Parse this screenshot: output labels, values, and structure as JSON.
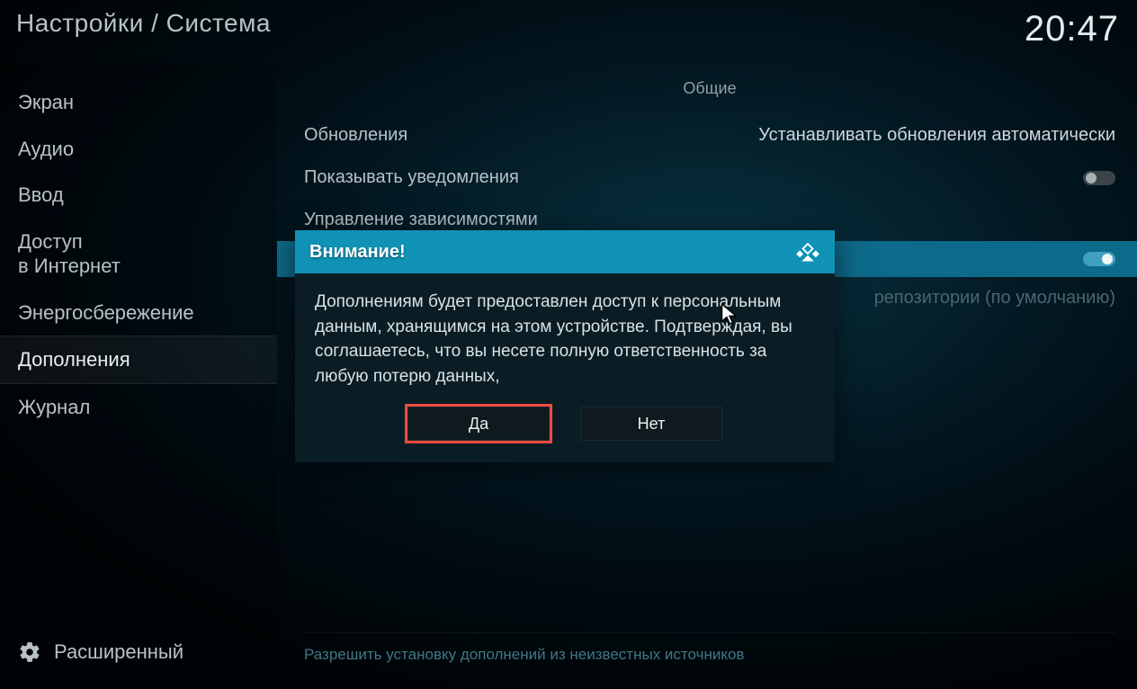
{
  "header": {
    "breadcrumb": "Настройки / Система",
    "clock": "20:47"
  },
  "sidebar": {
    "items": [
      {
        "label": "Экран"
      },
      {
        "label": "Аудио"
      },
      {
        "label": "Ввод"
      },
      {
        "label": "Доступ\nв Интернет"
      },
      {
        "label": "Энергосбережение"
      },
      {
        "label": "Дополнения"
      },
      {
        "label": "Журнал"
      }
    ],
    "level_label": "Расширенный"
  },
  "content": {
    "section_title": "Общие",
    "rows": {
      "updates": {
        "label": "Обновления",
        "value": "Устанавливать обновления автоматически"
      },
      "notifications": {
        "label": "Показывать уведомления"
      },
      "deps": {
        "label": "Управление зависимостями"
      },
      "unknown_highlight_value": "",
      "repos": {
        "value": "репозитории (по умолчанию)"
      }
    },
    "bottom_hint": "Разрешить установку дополнений из неизвестных источников"
  },
  "dialog": {
    "title": "Внимание!",
    "body": "Дополнениям будет предоставлен доступ к персональным данным, хранящимся на этом устройстве. Подтверждая, вы соглашаетесь, что вы несете полную ответственность за любую потерю данных,",
    "yes": "Да",
    "no": "Нет"
  }
}
